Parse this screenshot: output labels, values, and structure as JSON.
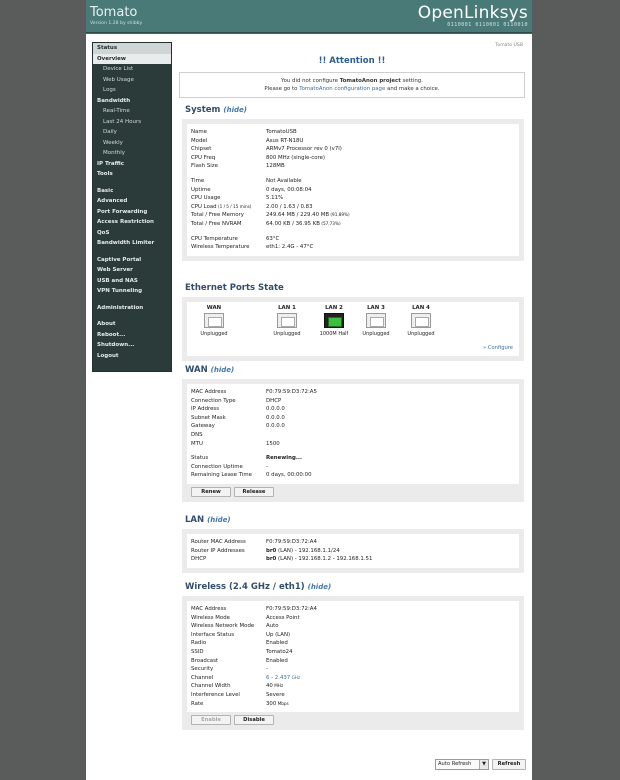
{
  "header": {
    "brand": "Tomato",
    "version": "Version 1.28 by shibby",
    "product": "OpenLinksys",
    "binary": "0110001 0110001 0110010"
  },
  "page_id": "Tomato USB",
  "sidebar": {
    "groups": [
      [
        {
          "label": "Status",
          "type": "sel-head"
        },
        {
          "label": "Overview",
          "type": "sel"
        },
        {
          "label": "Device List",
          "type": "sub"
        },
        {
          "label": "Web Usage",
          "type": "sub"
        },
        {
          "label": "Logs",
          "type": "sub"
        },
        {
          "label": "Bandwidth",
          "type": "head"
        },
        {
          "label": "Real-Time",
          "type": "sub"
        },
        {
          "label": "Last 24 Hours",
          "type": "sub"
        },
        {
          "label": "Daily",
          "type": "sub"
        },
        {
          "label": "Weekly",
          "type": "sub"
        },
        {
          "label": "Monthly",
          "type": "sub"
        },
        {
          "label": "IP Traffic",
          "type": "head"
        },
        {
          "label": "Tools",
          "type": "head"
        }
      ],
      [
        {
          "label": "Basic",
          "type": "head"
        },
        {
          "label": "Advanced",
          "type": "head"
        },
        {
          "label": "Port Forwarding",
          "type": "head"
        },
        {
          "label": "Access Restriction",
          "type": "head"
        },
        {
          "label": "QoS",
          "type": "head"
        },
        {
          "label": "Bandwidth Limiter",
          "type": "head"
        }
      ],
      [
        {
          "label": "Captive Portal",
          "type": "head"
        },
        {
          "label": "Web Server",
          "type": "head"
        },
        {
          "label": "USB and NAS",
          "type": "head"
        },
        {
          "label": "VPN Tunneling",
          "type": "head"
        }
      ],
      [
        {
          "label": "Administration",
          "type": "head"
        }
      ],
      [
        {
          "label": "About",
          "type": "head"
        },
        {
          "label": "Reboot...",
          "type": "head"
        },
        {
          "label": "Shutdown...",
          "type": "head"
        },
        {
          "label": "Logout",
          "type": "head"
        }
      ]
    ]
  },
  "attention": {
    "title": "!! Attention !!",
    "line1_pre": "You did not configure ",
    "line1_bold": "TomatoAnon project",
    "line1_post": " setting.",
    "line2_pre": "Please go to ",
    "line2_link": "TomatoAnon configuration page",
    "line2_post": " and make a choice."
  },
  "hide_label": "(hide)",
  "system": {
    "title": "System",
    "rows": [
      {
        "k": "Name",
        "v": "TomatoUSB"
      },
      {
        "k": "Model",
        "v": "Asus RT-N18U"
      },
      {
        "k": "Chipset",
        "v": "ARMv7 Processor rev 0 (v7l)"
      },
      {
        "k": "CPU Freq",
        "v": "800 MHz (single-core)"
      },
      {
        "k": "Flash Size",
        "v": "128MB"
      },
      {
        "spacer": true
      },
      {
        "k": "Time",
        "v": "Not Available"
      },
      {
        "k": "Uptime",
        "v": "0 days, 00:08:04"
      },
      {
        "k": "CPU Usage",
        "v": "5.11%"
      },
      {
        "k": "CPU Load",
        "k_small": " (1 / 5 / 15 mins)",
        "v": "2.00 / 1.63 / 0.83"
      },
      {
        "k": "Total / Free Memory",
        "v": "249.64 MB / 229.40 MB",
        "v_small": " (91.89%)"
      },
      {
        "k": "Total / Free NVRAM",
        "v": "64.00 KB / 36.95 KB",
        "v_small": " (57.73%)"
      },
      {
        "spacer": true
      },
      {
        "k": "CPU Temperature",
        "v": "63°C"
      },
      {
        "k": "Wireless Temperature",
        "v": "eth1: 2.4G - 47°C"
      }
    ]
  },
  "ports": {
    "title": "Ethernet Ports State",
    "items": [
      {
        "name": "WAN",
        "state": "Unplugged",
        "on": false
      },
      {
        "name": "LAN 1",
        "state": "Unplugged",
        "on": false
      },
      {
        "name": "LAN 2",
        "state": "1000M Half",
        "on": true
      },
      {
        "name": "LAN 3",
        "state": "Unplugged",
        "on": false
      },
      {
        "name": "LAN 4",
        "state": "Unplugged",
        "on": false
      }
    ],
    "configure": "» Configure"
  },
  "wan": {
    "title": "WAN",
    "rows": [
      {
        "k": "MAC Address",
        "v": "F0:79:59:D3:72:A5"
      },
      {
        "k": "Connection Type",
        "v": "DHCP"
      },
      {
        "k": "IP Address",
        "v": "0.0.0.0"
      },
      {
        "k": "Subnet Mask",
        "v": "0.0.0.0"
      },
      {
        "k": "Gateway",
        "v": "0.0.0.0"
      },
      {
        "k": "DNS",
        "v": ""
      },
      {
        "k": "MTU",
        "v": "1500"
      },
      {
        "spacer": true
      },
      {
        "k": "Status",
        "v": "Renewing...",
        "bold": true
      },
      {
        "k": "Connection Uptime",
        "v": "-"
      },
      {
        "k": "Remaining Lease Time",
        "v": "0 days, 00:00:00"
      }
    ],
    "renew": "Renew",
    "release": "Release"
  },
  "lan": {
    "title": "LAN",
    "rows": [
      {
        "k": "Router MAC Address",
        "v": "F0:79:59:D3:72:A4"
      },
      {
        "k": "Router IP Addresses",
        "vb": "br0",
        "v": " (LAN) - 192.168.1.1/24"
      },
      {
        "k": "DHCP",
        "vb": "br0",
        "v": " (LAN) - 192.168.1.2 - 192.168.1.51"
      }
    ]
  },
  "wireless": {
    "title": "Wireless (2.4 GHz / eth1)",
    "rows": [
      {
        "k": "MAC Address",
        "v": "F0:79:59:D3:72:A4"
      },
      {
        "k": "Wireless Mode",
        "v": "Access Point"
      },
      {
        "k": "Wireless Network Mode",
        "v": "Auto"
      },
      {
        "k": "Interface Status",
        "v": "Up (LAN)"
      },
      {
        "k": "Radio",
        "v": "Enabled"
      },
      {
        "k": "SSID",
        "v": "Tomato24"
      },
      {
        "k": "Broadcast",
        "v": "Enabled"
      },
      {
        "k": "Security",
        "v": "-"
      },
      {
        "k": "Channel",
        "v": "6 - 2.437",
        "v_small": " GHz",
        "link": true
      },
      {
        "k": "Channel Width",
        "v": "40",
        "v_small": " MHz"
      },
      {
        "k": "Interference Level",
        "v": "Severe"
      },
      {
        "k": "Rate",
        "v": "300",
        "v_small": " Mbps"
      }
    ],
    "enable": "Enable",
    "disable": "Disable"
  },
  "footer": {
    "refresh_option": "Auto Refresh",
    "refresh_button": "Refresh"
  }
}
